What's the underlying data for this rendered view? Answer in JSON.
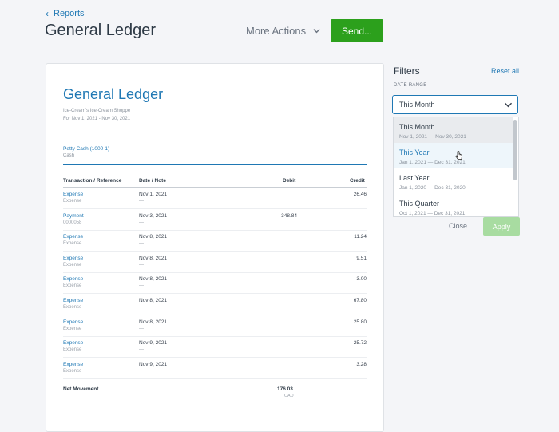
{
  "header": {
    "back_label": "Reports",
    "page_title": "General Ledger",
    "more_actions_label": "More Actions",
    "send_label": "Send..."
  },
  "report": {
    "title": "General Ledger",
    "company": "Ice-Cream's Ice-Cream Shoppe",
    "period": "For Nov 1, 2021 - Nov 30, 2021",
    "account": "Petty Cash (1000-1)",
    "account_type": "Cash",
    "columns": {
      "transaction": "Transaction / Reference",
      "date": "Date / Note",
      "debit": "Debit",
      "credit": "Credit"
    },
    "rows": [
      {
        "tx": "Expense",
        "ref": "Expense",
        "date": "Nov 1, 2021",
        "note": "—",
        "debit": "",
        "credit": "26.46"
      },
      {
        "tx": "Payment",
        "ref": "0000058",
        "date": "Nov 3, 2021",
        "note": "—",
        "debit": "348.84",
        "credit": ""
      },
      {
        "tx": "Expense",
        "ref": "Expense",
        "date": "Nov 8, 2021",
        "note": "—",
        "debit": "",
        "credit": "11.24"
      },
      {
        "tx": "Expense",
        "ref": "Expense",
        "date": "Nov 8, 2021",
        "note": "—",
        "debit": "",
        "credit": "9.51"
      },
      {
        "tx": "Expense",
        "ref": "Expense",
        "date": "Nov 8, 2021",
        "note": "—",
        "debit": "",
        "credit": "3.00"
      },
      {
        "tx": "Expense",
        "ref": "Expense",
        "date": "Nov 8, 2021",
        "note": "—",
        "debit": "",
        "credit": "67.80"
      },
      {
        "tx": "Expense",
        "ref": "Expense",
        "date": "Nov 8, 2021",
        "note": "—",
        "debit": "",
        "credit": "25.80"
      },
      {
        "tx": "Expense",
        "ref": "Expense",
        "date": "Nov 9, 2021",
        "note": "—",
        "debit": "",
        "credit": "25.72"
      },
      {
        "tx": "Expense",
        "ref": "Expense",
        "date": "Nov 9, 2021",
        "note": "—",
        "debit": "",
        "credit": "3.28"
      }
    ],
    "net_label": "Net Movement",
    "net_value": "176.03",
    "net_currency": "CAD"
  },
  "filters": {
    "title": "Filters",
    "reset_label": "Reset all",
    "date_range_label": "DATE RANGE",
    "selected": "This Month",
    "options": [
      {
        "name": "This Month",
        "range": "Nov 1, 2021 — Nov 30, 2021"
      },
      {
        "name": "This Year",
        "range": "Jan 1, 2021 — Dec 31, 2021"
      },
      {
        "name": "Last Year",
        "range": "Jan 1, 2020 — Dec 31, 2020"
      },
      {
        "name": "This Quarter",
        "range": "Oct 1, 2021 — Dec 31, 2021"
      }
    ],
    "close_label": "Close",
    "apply_label": "Apply"
  },
  "colors": {
    "accent": "#1f78b4",
    "primary_button": "#2ca01c",
    "apply_disabled": "#a8dca1"
  },
  "icons": [
    "chevron-left-icon",
    "chevron-down-icon",
    "pointer-cursor-icon"
  ]
}
